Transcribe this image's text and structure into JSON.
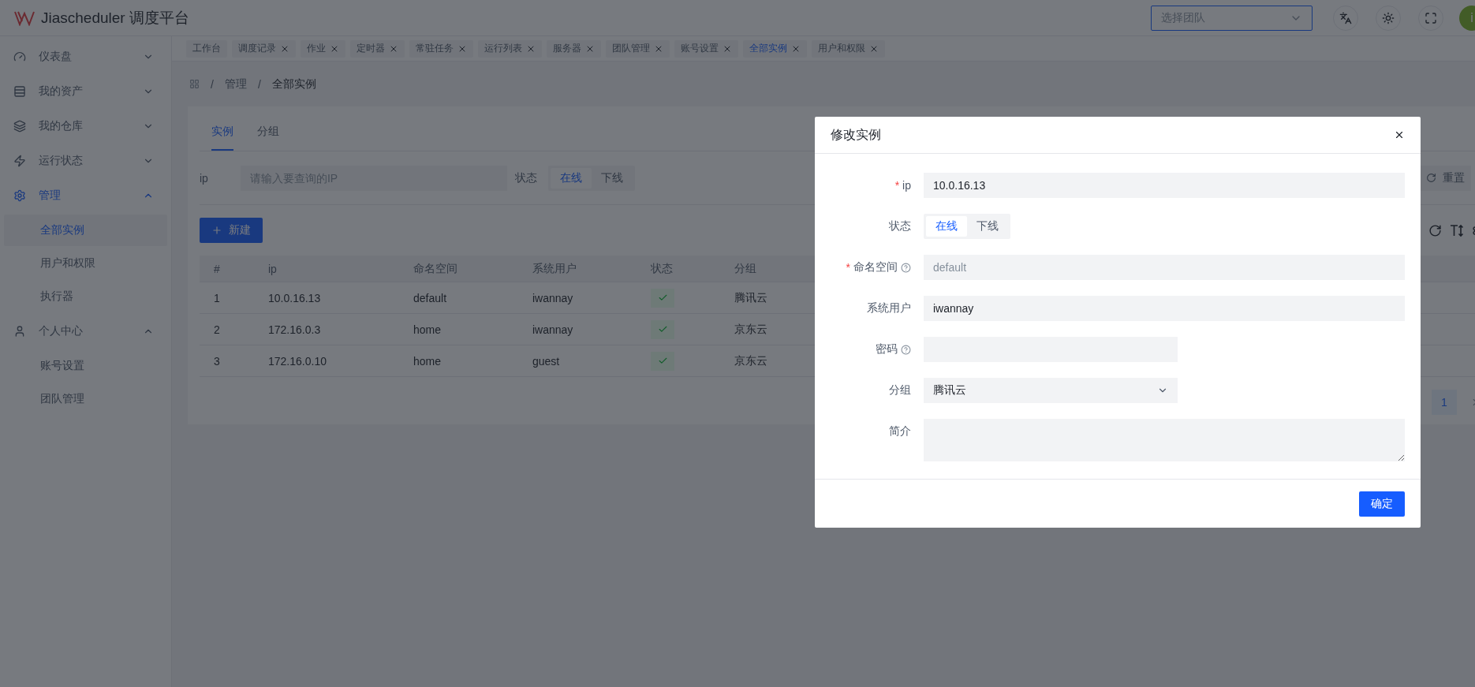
{
  "app": {
    "logo_text": "Jiascheduler 调度平台"
  },
  "header": {
    "team_select": {
      "placeholder": "选择团队"
    },
    "avatar": "i"
  },
  "sidebar": {
    "items": [
      {
        "label": "仪表盘",
        "expanded": false,
        "selected": false
      },
      {
        "label": "我的资产",
        "expanded": false,
        "selected": false
      },
      {
        "label": "我的仓库",
        "expanded": false,
        "selected": false
      },
      {
        "label": "运行状态",
        "expanded": false,
        "selected": false
      },
      {
        "label": "管理",
        "expanded": true,
        "selected": true,
        "children": [
          {
            "label": "全部实例",
            "selected": true
          },
          {
            "label": "用户和权限",
            "selected": false
          },
          {
            "label": "执行器",
            "selected": false
          }
        ]
      },
      {
        "label": "个人中心",
        "expanded": true,
        "selected": false,
        "children": [
          {
            "label": "账号设置",
            "selected": false
          },
          {
            "label": "团队管理",
            "selected": false
          }
        ]
      }
    ]
  },
  "tabs": [
    {
      "label": "工作台",
      "closable": false,
      "selected": false
    },
    {
      "label": "调度记录",
      "closable": true,
      "selected": false
    },
    {
      "label": "作业",
      "closable": true,
      "selected": false
    },
    {
      "label": "定时器",
      "closable": true,
      "selected": false
    },
    {
      "label": "常驻任务",
      "closable": true,
      "selected": false
    },
    {
      "label": "运行列表",
      "closable": true,
      "selected": false
    },
    {
      "label": "服务器",
      "closable": true,
      "selected": false
    },
    {
      "label": "团队管理",
      "closable": true,
      "selected": false
    },
    {
      "label": "账号设置",
      "closable": true,
      "selected": false
    },
    {
      "label": "全部实例",
      "closable": true,
      "selected": true
    },
    {
      "label": "用户和权限",
      "closable": true,
      "selected": false
    }
  ],
  "breadcrumb": [
    {
      "separator": "/",
      "label": "管理"
    },
    {
      "separator": "/",
      "label": "全部实例"
    }
  ],
  "page_tabs": [
    {
      "label": "实例",
      "selected": true
    },
    {
      "label": "分组",
      "selected": false
    }
  ],
  "filter": {
    "ip_label": "ip",
    "ip_placeholder": "请输入要查询的IP",
    "status_label": "状态",
    "status_options": [
      {
        "label": "在线",
        "selected": true
      },
      {
        "label": "下线",
        "selected": false
      }
    ],
    "reset_button": "重置"
  },
  "new_button": "新建",
  "table": {
    "columns": [
      "#",
      "ip",
      "命名空间",
      "系统用户",
      "状态",
      "分组"
    ],
    "rows": [
      {
        "index": "1",
        "ip": "10.0.16.13",
        "namespace": "default",
        "user": "iwannay",
        "online": true,
        "group": "腾讯云"
      },
      {
        "index": "2",
        "ip": "172.16.0.3",
        "namespace": "home",
        "user": "iwannay",
        "online": true,
        "group": "京东云"
      },
      {
        "index": "3",
        "ip": "172.16.0.10",
        "namespace": "home",
        "user": "guest",
        "online": true,
        "group": "京东云"
      }
    ]
  },
  "pagination": {
    "pages": [
      {
        "label": "1",
        "selected": true
      }
    ]
  },
  "modal": {
    "title": "修改实例",
    "fields": [
      {
        "kind": "text",
        "label": "ip",
        "required_mark": "*",
        "value": "10.0.16.13"
      },
      {
        "kind": "segmented",
        "label": "状态",
        "options": [
          {
            "label": "在线",
            "selected": true
          },
          {
            "label": "下线",
            "selected": false
          }
        ]
      },
      {
        "kind": "text",
        "label": "命名空间",
        "required_mark": "*",
        "help": true,
        "placeholder": "default"
      },
      {
        "kind": "text",
        "label": "系统用户",
        "value": "iwannay"
      },
      {
        "kind": "password",
        "label": "密码",
        "help": true
      },
      {
        "kind": "select",
        "label": "分组",
        "value": "腾讯云"
      },
      {
        "kind": "textarea",
        "label": "简介"
      }
    ],
    "confirm_button": "确定"
  }
}
